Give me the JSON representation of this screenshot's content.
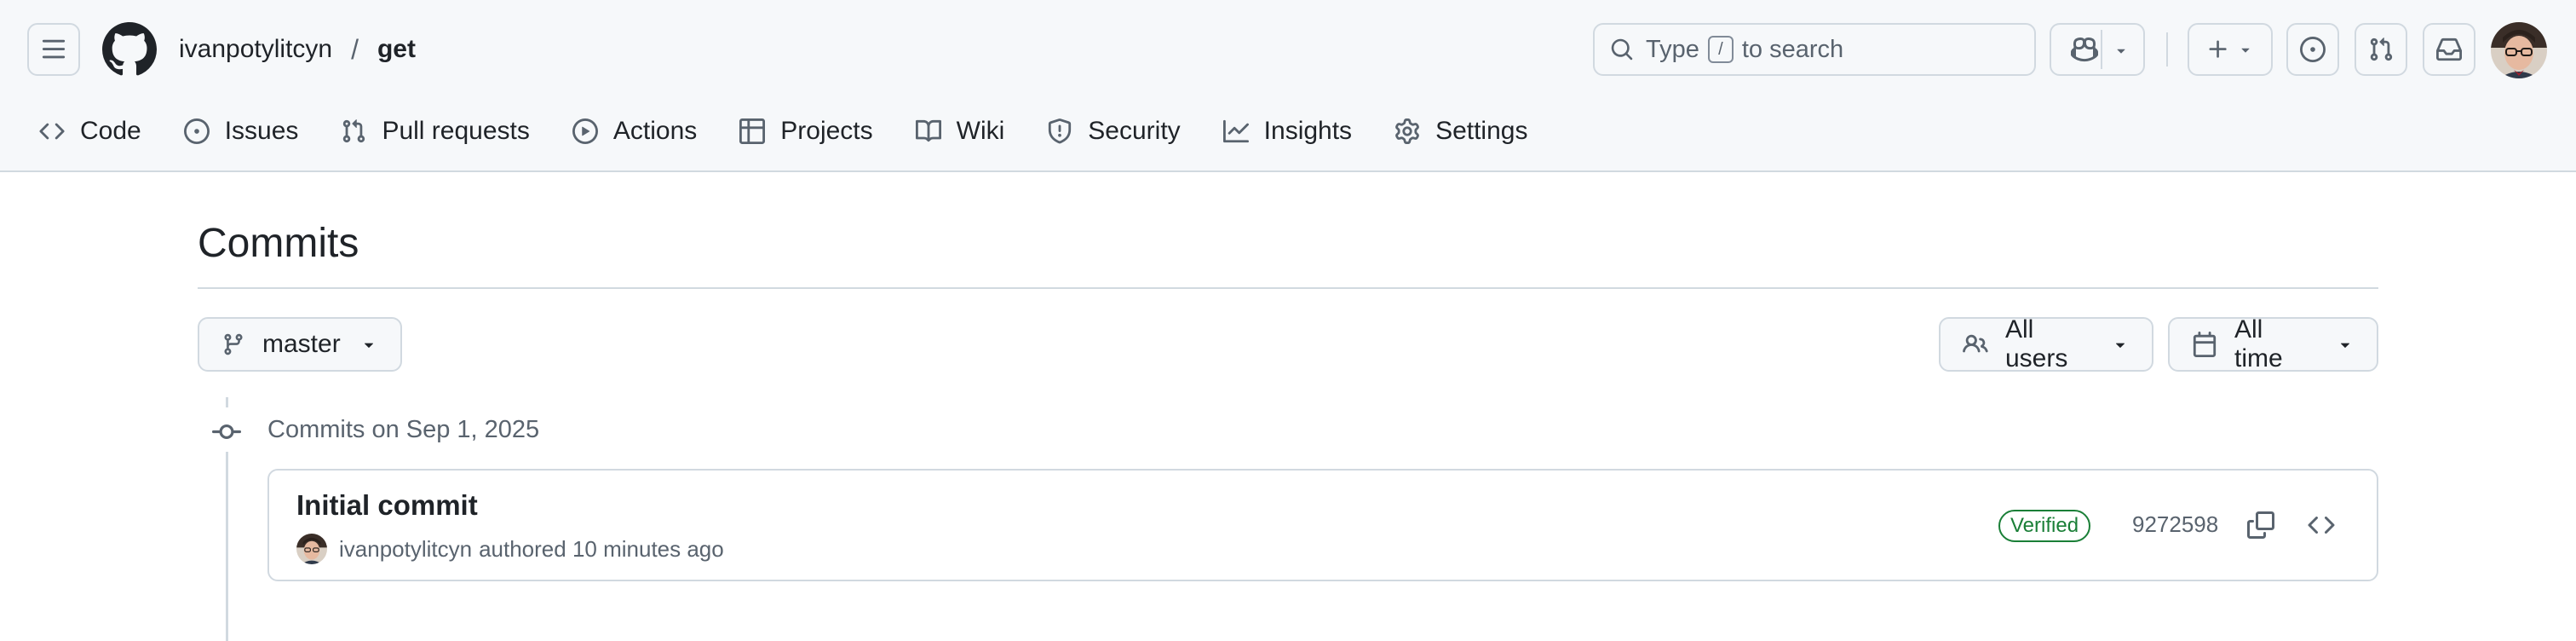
{
  "header": {
    "owner": "ivanpotylitcyn",
    "separator": "/",
    "repo": "get",
    "search": {
      "prefix": "Type",
      "key": "/",
      "suffix": "to search"
    }
  },
  "repo_nav": {
    "items": [
      {
        "label": "Code",
        "icon": "code-icon"
      },
      {
        "label": "Issues",
        "icon": "issue-opened-icon"
      },
      {
        "label": "Pull requests",
        "icon": "git-pull-request-icon"
      },
      {
        "label": "Actions",
        "icon": "play-icon"
      },
      {
        "label": "Projects",
        "icon": "table-icon"
      },
      {
        "label": "Wiki",
        "icon": "book-icon"
      },
      {
        "label": "Security",
        "icon": "shield-icon"
      },
      {
        "label": "Insights",
        "icon": "graph-icon"
      },
      {
        "label": "Settings",
        "icon": "gear-icon"
      }
    ]
  },
  "main": {
    "title": "Commits",
    "branch": "master",
    "users_filter": "All users",
    "time_filter": "All time",
    "date_heading": "Commits on Sep 1, 2025",
    "commits": [
      {
        "title": "Initial commit",
        "author": "ivanpotylitcyn",
        "action": "authored 10 minutes ago",
        "badge": "Verified",
        "sha": "9272598"
      }
    ]
  },
  "colors": {
    "header_bg": "#f6f8fa",
    "border": "#d1d9e0",
    "text": "#1f2328",
    "muted": "#59636e",
    "verified": "#1a7f37"
  }
}
